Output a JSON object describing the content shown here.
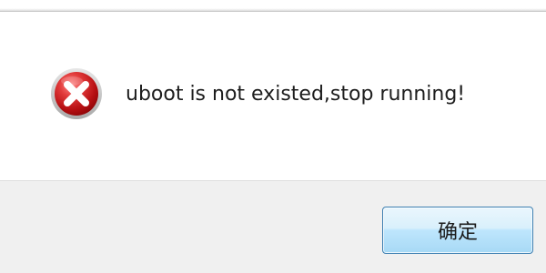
{
  "dialog": {
    "message": "uboot is not existed,stop running!",
    "icon": "error-icon",
    "ok_label": "确定"
  },
  "colors": {
    "icon_red": "#c8191c",
    "button_border": "#3c7fb1",
    "footer_bg": "#f0f0f0"
  }
}
